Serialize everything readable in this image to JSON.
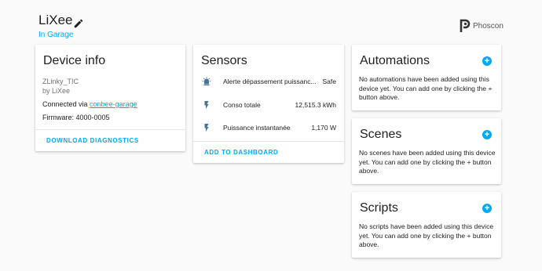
{
  "header": {
    "device_name": "LiXee",
    "area": "In Garage",
    "brand": "Phoscon"
  },
  "device_info": {
    "title": "Device info",
    "model": "ZLinky_TIC",
    "manufacturer": "by LiXee",
    "connected_prefix": "Connected via ",
    "connected_link": "conbee-garage",
    "firmware": "Firmware: 4000-0005",
    "action": "DOWNLOAD DIAGNOSTICS"
  },
  "sensors": {
    "title": "Sensors",
    "items": [
      {
        "name": "Alerte dépassement puissanc...",
        "value": "Safe",
        "icon": "alarm-light-icon"
      },
      {
        "name": "Conso totale",
        "value": "12,515.3 kWh",
        "icon": "flash-icon"
      },
      {
        "name": "Puissance instantanée",
        "value": "1,170 W",
        "icon": "flash-icon"
      }
    ],
    "action": "ADD TO DASHBOARD"
  },
  "automations": {
    "title": "Automations",
    "text": "No automations have been added using this device yet. You can add one by clicking the + button above.",
    "plus": "+"
  },
  "scenes": {
    "title": "Scenes",
    "text": "No scenes have been added using this device yet. You can add one by clicking the + button above.",
    "plus": "+"
  },
  "scripts": {
    "title": "Scripts",
    "text": "No scripts have been added using this device yet. You can add one by clicking the + button above.",
    "plus": "+"
  },
  "colors": {
    "accent": "#03a9f4",
    "icon": "#44739e",
    "background": "#fafafa"
  }
}
